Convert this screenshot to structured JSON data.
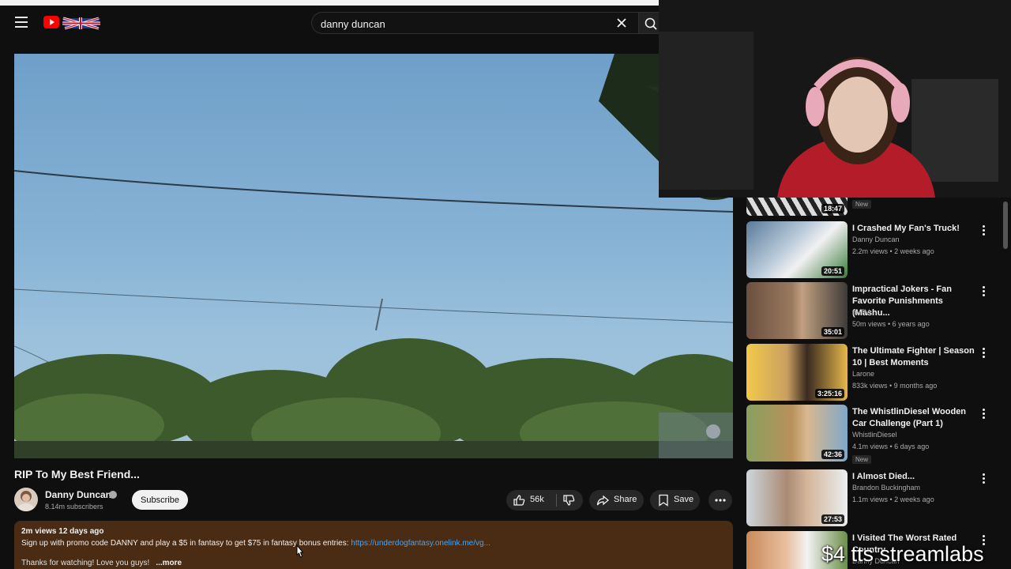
{
  "header": {
    "search_value": "danny duncan",
    "search_placeholder": "Search"
  },
  "video": {
    "title": "RIP To My Best Friend...",
    "channel": "Danny Duncan",
    "subscribers": "8.14m subscribers",
    "subscribe_label": "Subscribe",
    "likes": "56k",
    "share_label": "Share",
    "save_label": "Save"
  },
  "description": {
    "meta": "2m views  12 days ago",
    "promo": "Sign up with promo code DANNY and play a $5 in fantasy to get $75 in fantasy bonus entries: ",
    "link": "https://underdogfantasy.onelink.me/vg...",
    "thanks": "Thanks for watching! Love you guys!",
    "more_label": "...more"
  },
  "sidebar": {
    "items": [
      {
        "title": "",
        "channel": "",
        "stats": "",
        "duration": "18:47",
        "badge": "New"
      },
      {
        "title": "I Crashed My Fan's Truck!",
        "channel": "Danny Duncan",
        "stats": "2.2m views • 2 weeks ago",
        "duration": "20:51",
        "badge": ""
      },
      {
        "title": "Impractical Jokers - Fan Favorite Punishments (Mashu...",
        "channel": "truTV",
        "stats": "50m views • 6 years ago",
        "duration": "35:01",
        "badge": ""
      },
      {
        "title": "The Ultimate Fighter | Season 10 | Best Moments",
        "channel": "Larone",
        "stats": "833k views • 9 months ago",
        "duration": "3:25:16",
        "badge": ""
      },
      {
        "title": "The WhistlinDiesel Wooden Car Challenge (Part 1)",
        "channel": "WhistlinDiesel",
        "stats": "4.1m views • 6 days ago",
        "duration": "42:36",
        "badge": "New"
      },
      {
        "title": "I Almost Died...",
        "channel": "Brandon Buckingham",
        "stats": "1.1m views • 2 weeks ago",
        "duration": "27:53",
        "badge": ""
      },
      {
        "title": "I Visited The Worst Rated Country",
        "channel": "Danny Duncan",
        "stats": "",
        "duration": "",
        "badge": ""
      }
    ]
  },
  "overlay": {
    "watermark": "$4 tts streamlabs"
  },
  "colors": {
    "background": "#0f0f0f",
    "description_bg": "#4a2b14",
    "link": "#3ea6ff",
    "youtube_red": "#ff0000"
  }
}
